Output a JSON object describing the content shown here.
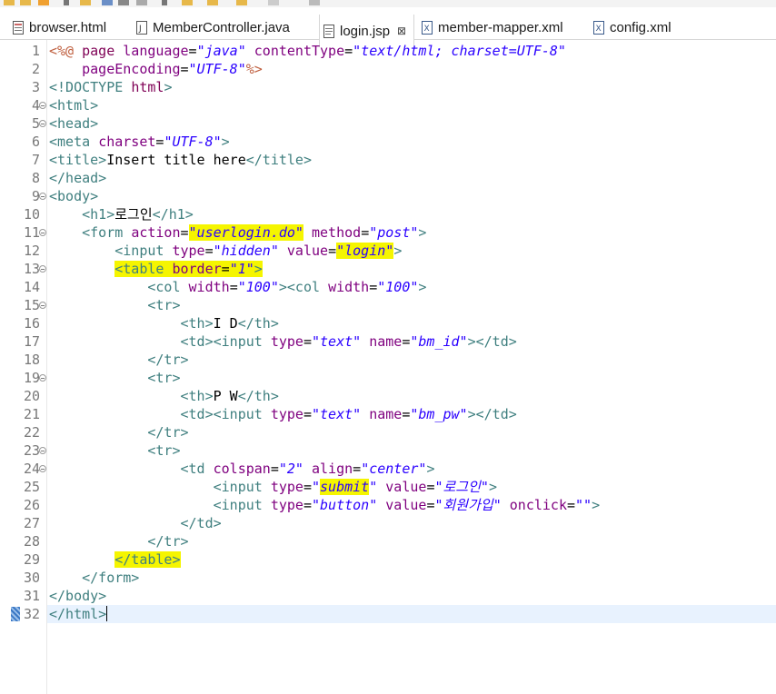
{
  "tabs": [
    {
      "label": "browser.html",
      "icon": "html-file-icon",
      "active": false
    },
    {
      "label": "MemberController.java",
      "icon": "java-file-icon",
      "active": false
    },
    {
      "label": "login.jsp",
      "icon": "jsp-file-icon",
      "active": true,
      "close": "⊠"
    },
    {
      "label": "member-mapper.xml",
      "icon": "xml-file-icon",
      "active": false
    },
    {
      "label": "config.xml",
      "icon": "xml-file-icon",
      "active": false
    }
  ],
  "line_numbers": [
    "1",
    "2",
    "3",
    "4",
    "5",
    "6",
    "7",
    "8",
    "9",
    "10",
    "11",
    "12",
    "13",
    "14",
    "15",
    "16",
    "17",
    "18",
    "19",
    "20",
    "21",
    "22",
    "23",
    "24",
    "25",
    "26",
    "27",
    "28",
    "29",
    "30",
    "31",
    "32"
  ],
  "lines": [
    [
      {
        "c": "j",
        "t": "<%@ "
      },
      {
        "c": "k",
        "t": "page"
      },
      {
        "c": "",
        "t": " "
      },
      {
        "c": "a",
        "t": "language"
      },
      {
        "c": "",
        "t": "="
      },
      {
        "c": "v",
        "t": "\"java\""
      },
      {
        "c": "",
        "t": " "
      },
      {
        "c": "a",
        "t": "contentType"
      },
      {
        "c": "",
        "t": "="
      },
      {
        "c": "v",
        "t": "\"text/html; charset=UTF-8\""
      }
    ],
    [
      {
        "c": "",
        "t": "    "
      },
      {
        "c": "a",
        "t": "pageEncoding"
      },
      {
        "c": "",
        "t": "="
      },
      {
        "c": "v",
        "t": "\"UTF-8\""
      },
      {
        "c": "j",
        "t": "%>"
      }
    ],
    [
      {
        "c": "t",
        "t": "<!DOCTYPE "
      },
      {
        "c": "k",
        "t": "html"
      },
      {
        "c": "t",
        "t": ">"
      }
    ],
    [
      {
        "c": "t",
        "t": "<html>"
      }
    ],
    [
      {
        "c": "t",
        "t": "<head>"
      }
    ],
    [
      {
        "c": "t",
        "t": "<meta "
      },
      {
        "c": "a",
        "t": "charset"
      },
      {
        "c": "",
        "t": "="
      },
      {
        "c": "v",
        "t": "\"UTF-8\""
      },
      {
        "c": "t",
        "t": ">"
      }
    ],
    [
      {
        "c": "t",
        "t": "<title>"
      },
      {
        "c": "",
        "t": "Insert title here"
      },
      {
        "c": "t",
        "t": "</title>"
      }
    ],
    [
      {
        "c": "t",
        "t": "</head>"
      }
    ],
    [
      {
        "c": "t",
        "t": "<body>"
      }
    ],
    [
      {
        "c": "",
        "t": "    "
      },
      {
        "c": "t",
        "t": "<h1>"
      },
      {
        "c": "",
        "t": "로그인"
      },
      {
        "c": "t",
        "t": "</h1>"
      }
    ],
    [
      {
        "c": "",
        "t": "    "
      },
      {
        "c": "t",
        "t": "<form "
      },
      {
        "c": "a",
        "t": "action"
      },
      {
        "c": "",
        "t": "="
      },
      {
        "c": "v",
        "t": "\"userlogin.do\"",
        "h": 1
      },
      {
        "c": "",
        "t": " "
      },
      {
        "c": "a",
        "t": "method"
      },
      {
        "c": "",
        "t": "="
      },
      {
        "c": "v",
        "t": "\"post\""
      },
      {
        "c": "t",
        "t": ">"
      }
    ],
    [
      {
        "c": "",
        "t": "        "
      },
      {
        "c": "t",
        "t": "<input "
      },
      {
        "c": "a",
        "t": "type"
      },
      {
        "c": "",
        "t": "="
      },
      {
        "c": "v",
        "t": "\"hidden\""
      },
      {
        "c": "",
        "t": " "
      },
      {
        "c": "a",
        "t": "value"
      },
      {
        "c": "",
        "t": "="
      },
      {
        "c": "v",
        "t": "\"login\"",
        "h": 1
      },
      {
        "c": "t",
        "t": ">"
      }
    ],
    [
      {
        "c": "",
        "t": "        "
      },
      {
        "c": "t",
        "t": "<table ",
        "h": 1
      },
      {
        "c": "a",
        "t": "border",
        "h": 1
      },
      {
        "c": "",
        "t": "=",
        "h": 1
      },
      {
        "c": "v",
        "t": "\"1\"",
        "h": 1
      },
      {
        "c": "t",
        "t": ">",
        "h": 1
      }
    ],
    [
      {
        "c": "",
        "t": "            "
      },
      {
        "c": "t",
        "t": "<col "
      },
      {
        "c": "a",
        "t": "width"
      },
      {
        "c": "",
        "t": "="
      },
      {
        "c": "v",
        "t": "\"100\""
      },
      {
        "c": "t",
        "t": "><col "
      },
      {
        "c": "a",
        "t": "width"
      },
      {
        "c": "",
        "t": "="
      },
      {
        "c": "v",
        "t": "\"100\""
      },
      {
        "c": "t",
        "t": ">"
      }
    ],
    [
      {
        "c": "",
        "t": "            "
      },
      {
        "c": "t",
        "t": "<tr>"
      }
    ],
    [
      {
        "c": "",
        "t": "                "
      },
      {
        "c": "t",
        "t": "<th>"
      },
      {
        "c": "",
        "t": "I D"
      },
      {
        "c": "t",
        "t": "</th>"
      }
    ],
    [
      {
        "c": "",
        "t": "                "
      },
      {
        "c": "t",
        "t": "<td><input "
      },
      {
        "c": "a",
        "t": "type"
      },
      {
        "c": "",
        "t": "="
      },
      {
        "c": "v",
        "t": "\"text\""
      },
      {
        "c": "",
        "t": " "
      },
      {
        "c": "a",
        "t": "name"
      },
      {
        "c": "",
        "t": "="
      },
      {
        "c": "v",
        "t": "\"bm_id\""
      },
      {
        "c": "t",
        "t": "></td>"
      }
    ],
    [
      {
        "c": "",
        "t": "            "
      },
      {
        "c": "t",
        "t": "</tr>"
      }
    ],
    [
      {
        "c": "",
        "t": "            "
      },
      {
        "c": "t",
        "t": "<tr>"
      }
    ],
    [
      {
        "c": "",
        "t": "                "
      },
      {
        "c": "t",
        "t": "<th>"
      },
      {
        "c": "",
        "t": "P W"
      },
      {
        "c": "t",
        "t": "</th>"
      }
    ],
    [
      {
        "c": "",
        "t": "                "
      },
      {
        "c": "t",
        "t": "<td><input "
      },
      {
        "c": "a",
        "t": "type"
      },
      {
        "c": "",
        "t": "="
      },
      {
        "c": "v",
        "t": "\"text\""
      },
      {
        "c": "",
        "t": " "
      },
      {
        "c": "a",
        "t": "name"
      },
      {
        "c": "",
        "t": "="
      },
      {
        "c": "v",
        "t": "\"bm_pw\""
      },
      {
        "c": "t",
        "t": "></td>"
      }
    ],
    [
      {
        "c": "",
        "t": "            "
      },
      {
        "c": "t",
        "t": "</tr>"
      }
    ],
    [
      {
        "c": "",
        "t": "            "
      },
      {
        "c": "t",
        "t": "<tr>"
      }
    ],
    [
      {
        "c": "",
        "t": "                "
      },
      {
        "c": "t",
        "t": "<td "
      },
      {
        "c": "a",
        "t": "colspan"
      },
      {
        "c": "",
        "t": "="
      },
      {
        "c": "v",
        "t": "\"2\""
      },
      {
        "c": "",
        "t": " "
      },
      {
        "c": "a",
        "t": "align"
      },
      {
        "c": "",
        "t": "="
      },
      {
        "c": "v",
        "t": "\"center\""
      },
      {
        "c": "t",
        "t": ">"
      }
    ],
    [
      {
        "c": "",
        "t": "                    "
      },
      {
        "c": "t",
        "t": "<input "
      },
      {
        "c": "a",
        "t": "type"
      },
      {
        "c": "",
        "t": "="
      },
      {
        "c": "v",
        "t": "\""
      },
      {
        "c": "v",
        "t": "submit",
        "h": 1
      },
      {
        "c": "v",
        "t": "\""
      },
      {
        "c": "",
        "t": " "
      },
      {
        "c": "a",
        "t": "value"
      },
      {
        "c": "",
        "t": "="
      },
      {
        "c": "v",
        "t": "\"로그인\""
      },
      {
        "c": "t",
        "t": ">"
      }
    ],
    [
      {
        "c": "",
        "t": "                    "
      },
      {
        "c": "t",
        "t": "<input "
      },
      {
        "c": "a",
        "t": "type"
      },
      {
        "c": "",
        "t": "="
      },
      {
        "c": "v",
        "t": "\"button\""
      },
      {
        "c": "",
        "t": " "
      },
      {
        "c": "a",
        "t": "value"
      },
      {
        "c": "",
        "t": "="
      },
      {
        "c": "v",
        "t": "\"회원가입\""
      },
      {
        "c": "",
        "t": " "
      },
      {
        "c": "a",
        "t": "onclick"
      },
      {
        "c": "",
        "t": "="
      },
      {
        "c": "v",
        "t": "\"\""
      },
      {
        "c": "t",
        "t": ">"
      }
    ],
    [
      {
        "c": "",
        "t": "                "
      },
      {
        "c": "t",
        "t": "</td>"
      }
    ],
    [
      {
        "c": "",
        "t": "            "
      },
      {
        "c": "t",
        "t": "</tr>"
      }
    ],
    [
      {
        "c": "",
        "t": "        "
      },
      {
        "c": "t",
        "t": "</table>",
        "h": 1
      }
    ],
    [
      {
        "c": "",
        "t": "    "
      },
      {
        "c": "t",
        "t": "</form>"
      }
    ],
    [
      {
        "c": "t",
        "t": "</body>"
      }
    ],
    [
      {
        "c": "t",
        "t": "</html>"
      }
    ]
  ],
  "folds": [
    "4",
    "5",
    "9",
    "11",
    "13",
    "15",
    "19",
    "23",
    "24"
  ],
  "current_line": "32",
  "colors": {
    "tag": "#3f7f7f",
    "attribute": "#7f007f",
    "value": "#2a00ff",
    "jsp": "#bf5f3f",
    "highlight": "#f5f500",
    "current_line": "#e8f2fe"
  }
}
